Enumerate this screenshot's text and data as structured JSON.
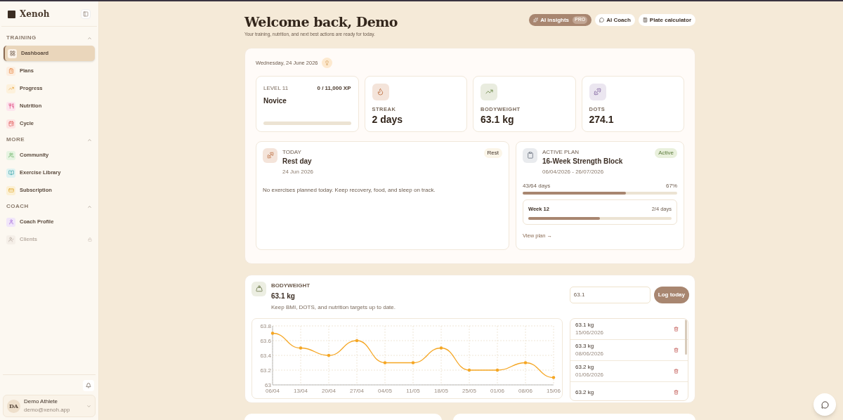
{
  "sidebar": {
    "brand": "Xenoh",
    "sections": [
      {
        "title": "TRAINING",
        "expanded": true,
        "items": [
          {
            "label": "Dashboard",
            "selected": true,
            "locked": false
          },
          {
            "label": "Plans",
            "selected": false,
            "locked": false
          },
          {
            "label": "Progress",
            "selected": false,
            "locked": false
          },
          {
            "label": "Nutrition",
            "selected": false,
            "locked": false
          },
          {
            "label": "Cycle",
            "selected": false,
            "locked": false
          }
        ]
      },
      {
        "title": "MORE",
        "expanded": true,
        "items": [
          {
            "label": "Community",
            "selected": false,
            "locked": false
          },
          {
            "label": "Exercise Library",
            "selected": false,
            "locked": false
          },
          {
            "label": "Subscription",
            "selected": false,
            "locked": false
          }
        ]
      },
      {
        "title": "COACH",
        "expanded": true,
        "items": [
          {
            "label": "Coach Profile",
            "selected": false,
            "locked": false
          },
          {
            "label": "Clients",
            "selected": false,
            "locked": true
          }
        ]
      }
    ],
    "user": {
      "initials": "DA",
      "name": "Demo Athlete",
      "email": "demo@xenoh.app"
    }
  },
  "header": {
    "title": "Welcome back, Demo",
    "subtitle": "Your training, nutrition, and next best actions are ready for today.",
    "actions": [
      {
        "kind": "insights",
        "label": "AI insights",
        "badge": "PRO"
      },
      {
        "kind": "coach",
        "label": "AI Coach"
      },
      {
        "kind": "plate",
        "label": "Plate calculator"
      }
    ]
  },
  "overview": {
    "date": "Wednesday, 24 June 2026",
    "stats": [
      {
        "kind": "level",
        "label": "LEVEL 11",
        "xp": "0 / 11,000 XP",
        "value": "Novice",
        "level": 0
      },
      {
        "kind": "streak",
        "label": "STREAK",
        "value": "2 days"
      },
      {
        "kind": "bodyweight",
        "label": "BODYWEIGHT",
        "value": "63.1 kg"
      },
      {
        "kind": "dots",
        "label": "DOTS",
        "value": "274.1"
      }
    ],
    "today": {
      "label": "TODAY",
      "title": "Rest day",
      "date": "24 Jun 2026",
      "badge": "Rest",
      "note": "No exercises planned today. Keep recovery, food, and sleep on track."
    },
    "plan": {
      "label": "ACTIVE PLAN",
      "title": "16-Week Strength Block",
      "range": "06/04/2026 - 26/07/2026",
      "badge": "Active",
      "days": "43/64 days",
      "percent": "67%",
      "level": 0.67,
      "week": {
        "title": "Week 12",
        "days": "2/4 days",
        "level": 0.5
      },
      "link": "View plan →"
    }
  },
  "bodyweight": {
    "label": "BODYWEIGHT",
    "value": "63.1 kg",
    "hint": "Keep BMI, DOTS, and nutrition targets up to date.",
    "input": "63.1",
    "button": "Log today",
    "chart_data": {
      "type": "line",
      "categories": [
        "06/04",
        "13/04",
        "20/04",
        "27/04",
        "04/05",
        "11/05",
        "18/05",
        "25/05",
        "01/06",
        "08/06",
        "15/06"
      ],
      "grid": true,
      "series": [
        {
          "color": "#f5a623",
          "values": [
            63.7,
            63.5,
            63.4,
            63.6,
            63.3,
            63.3,
            63.5,
            63.2,
            63.2,
            63.3,
            63.1
          ]
        }
      ],
      "ylim": [
        63,
        63.8
      ],
      "yticks": [
        {
          "value": 63,
          "label": "63"
        },
        {
          "value": 63.2,
          "label": "63.2"
        },
        {
          "value": 63.4,
          "label": "63.4"
        },
        {
          "value": 63.6,
          "label": "63.6"
        },
        {
          "value": 63.8,
          "label": "63.8"
        }
      ]
    },
    "entries": [
      {
        "weight": "63.1 kg",
        "date": "15/06/2026"
      },
      {
        "weight": "63.3 kg",
        "date": "08/06/2026"
      },
      {
        "weight": "63.2 kg",
        "date": "01/06/2026"
      },
      {
        "weight": "63.2 kg"
      }
    ]
  }
}
